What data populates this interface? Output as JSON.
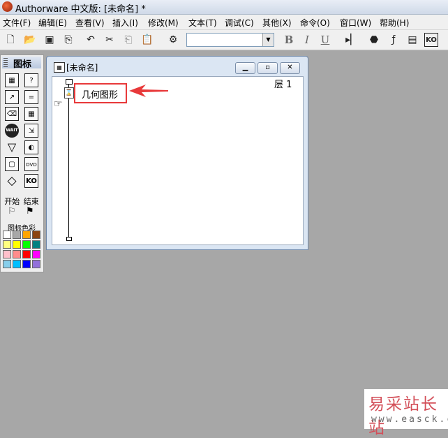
{
  "app": {
    "title": "Authorware 中文版: [未命名] *"
  },
  "menubar": {
    "items": [
      "文件(F)",
      "编辑(E)",
      "查看(V)",
      "插入(I)",
      "修改(M)",
      "文本(T)",
      "调试(C)",
      "其他(X)",
      "命令(O)",
      "窗口(W)",
      "帮助(H)"
    ]
  },
  "toolbar": {
    "font_value": "",
    "bold": "B",
    "italic": "I",
    "underline": "U"
  },
  "palette": {
    "title": "图标",
    "start_label": "开始",
    "end_label": "结束",
    "color_label": "图标色彩",
    "icon_texts": {
      "wait": "WAIT",
      "dvd": "DVD",
      "ko": "KO"
    },
    "swatches": [
      "#ffffff",
      "#a8a8a8",
      "#ffa500",
      "#8b4513",
      "#ffff80",
      "#ffff00",
      "#00ff00",
      "#008080",
      "#ffc0cb",
      "#ff8c8c",
      "#ff0000",
      "#ff00ff",
      "#87ceeb",
      "#00bfff",
      "#0000ff",
      "#9370db"
    ]
  },
  "flow_window": {
    "title": "[未命名]",
    "layer_label": "层  1",
    "node_label": "几何图形"
  },
  "watermark": {
    "main": "易采站长站",
    "url": "www.easck.com"
  },
  "colors": {
    "annotation": "#e8393a",
    "desktop": "#a7a7a7"
  }
}
